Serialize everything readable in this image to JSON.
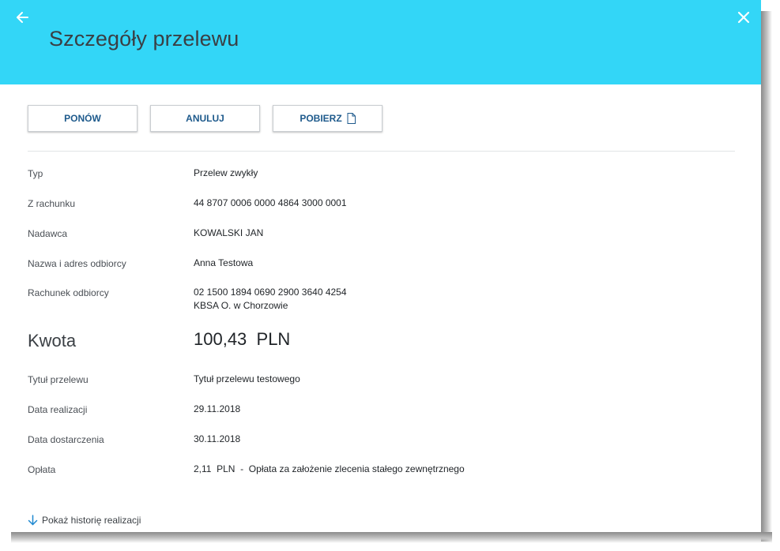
{
  "header": {
    "title": "Szczegóły przelewu"
  },
  "actions": {
    "repeat_label": "PONÓW",
    "cancel_label": "ANULUJ",
    "download_label": "POBIERZ"
  },
  "details": [
    {
      "label": "Typ",
      "value": "Przelew zwykły"
    },
    {
      "label": "Z rachunku",
      "value": "44 8707 0006 0000 4864 3000 0001"
    },
    {
      "label": "Nadawca",
      "value": "KOWALSKI JAN"
    },
    {
      "label": "Nazwa i adres odbiorcy",
      "value": "Anna Testowa"
    },
    {
      "label": "Rachunek odbiorcy",
      "value": "02 1500 1894 0690 2900 3640 4254",
      "value2": "KBSA O. w Chorzowie"
    }
  ],
  "amount": {
    "label": "Kwota",
    "value": "100,43  PLN"
  },
  "details_after": [
    {
      "label": "Tytuł przelewu",
      "value": "Tytuł przelewu testowego"
    },
    {
      "label": "Data realizacji",
      "value": "29.11.2018"
    },
    {
      "label": "Data dostarczenia",
      "value": "30.11.2018"
    },
    {
      "label": "Opłata",
      "value": "2,11  PLN  -  Opłata za założenie zlecenia stałego zewnętrznego"
    }
  ],
  "history_link": {
    "label": "Pokaż historię realizacji"
  },
  "colors": {
    "header_bg": "#33d6f7",
    "button_text": "#1e5a8c",
    "link_arrow": "#1e88d0"
  },
  "icons": {
    "back": "arrow-left-icon",
    "close": "close-icon",
    "download": "document-icon",
    "history": "arrow-down-icon"
  }
}
